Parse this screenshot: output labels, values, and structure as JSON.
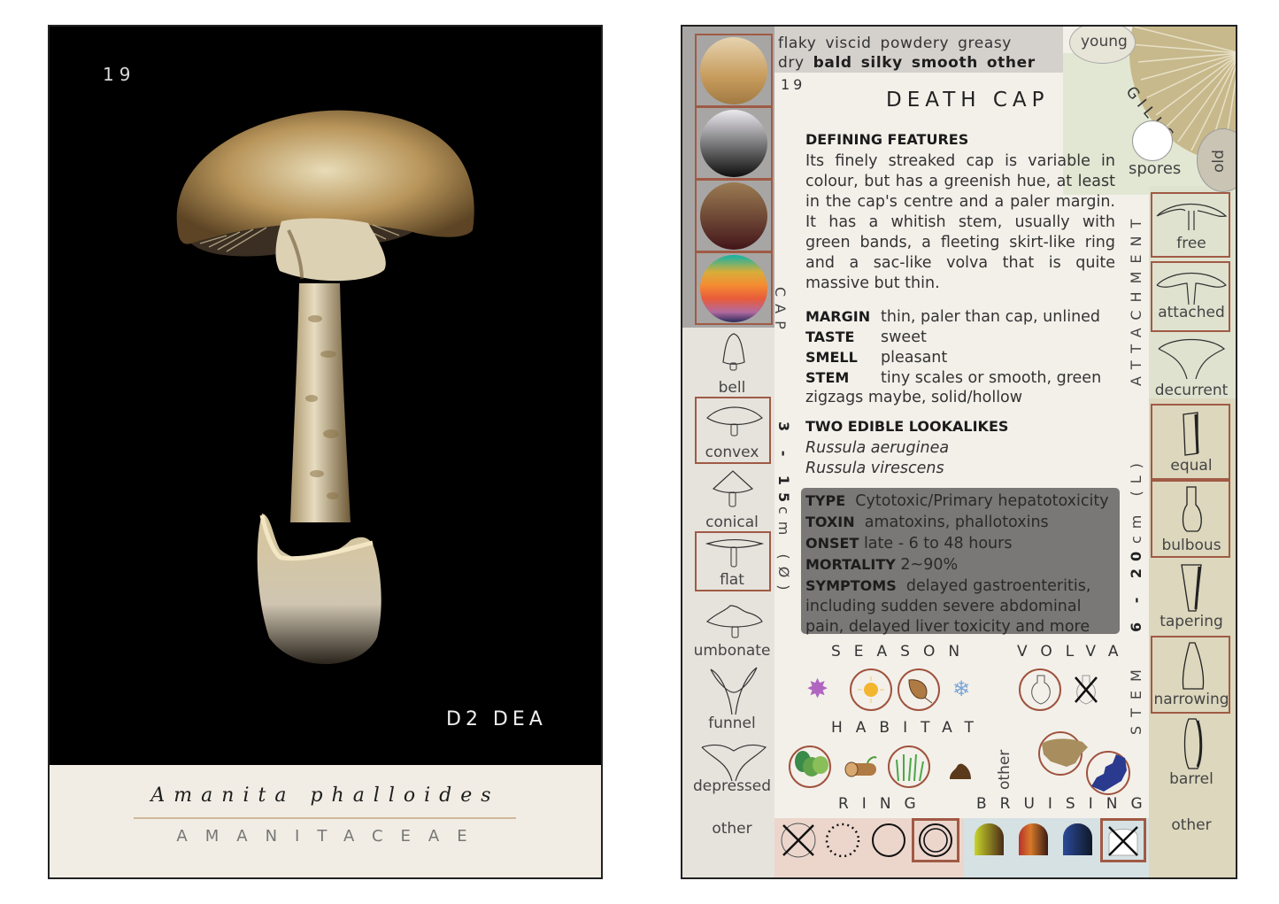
{
  "front": {
    "number": "19",
    "code": "D2 DEA",
    "latin_name": "Amanita phalloides",
    "family": "AMANITACEAE",
    "background_color": "#000000",
    "plate_color": "#f1ede4"
  },
  "back": {
    "textures": {
      "row1": [
        "flaky",
        "viscid",
        "powdery",
        "greasy"
      ],
      "row2_plain": [
        "dry"
      ],
      "row2_bold": [
        "bald",
        "silky",
        "smooth",
        "other"
      ]
    },
    "card_number": "19",
    "title": "DEATH CAP",
    "defining_features": {
      "heading": "DEFINING FEATURES",
      "text": "Its finely streaked cap is variable in colour, but has a greenish hue, at least in the cap's centre and a paler margin. It has a whitish stem, usually with green bands, a fleeting skirt-like ring and a sac-like volva that is quite massive but thin."
    },
    "attributes": [
      {
        "key": "MARGIN",
        "value": "thin, paler than cap, unlined"
      },
      {
        "key": "TASTE",
        "value": "sweet"
      },
      {
        "key": "SMELL",
        "value": "pleasant"
      },
      {
        "key": "STEM",
        "value": "tiny scales or smooth, green"
      }
    ],
    "stem_continuation": "zigzags maybe, solid/hollow",
    "lookalikes": {
      "heading": "TWO EDIBLE LOOKALIKES",
      "items": [
        "Russula aeruginea",
        "Russula virescens"
      ]
    },
    "toxicity": [
      {
        "key": "TYPE",
        "value": "Cytotoxic/Primary hepatotoxicity"
      },
      {
        "key": "TOXIN",
        "value": "amatoxins, phallotoxins"
      },
      {
        "key": "ONSET",
        "value": "late - 6 to 48 hours"
      },
      {
        "key": "MORTALITY",
        "value": "2~90%"
      },
      {
        "key": "SYMPTOMS",
        "value": "delayed gastroenteritis,"
      }
    ],
    "symptoms_continuation": [
      "including sudden severe abdominal",
      "pain, delayed liver toxicity and more"
    ],
    "sections": {
      "season": "SEASON",
      "volva": "VOLVA",
      "habitat": "HABITAT",
      "ring": "RING",
      "bruising": "BRUISING",
      "gills": "GILLS",
      "attachment": "ATTACHMENT",
      "cap": "CAP",
      "stem": "STEM"
    },
    "cap_size": {
      "range": "3 - 15",
      "unit": "cm (Ø)"
    },
    "stem_size": {
      "range": "6 - 20",
      "unit": "cm (L)"
    },
    "colour_swatches": [
      {
        "name": "tan",
        "top": "#e6d3b0",
        "bottom": "#b78a4c",
        "selected": true
      },
      {
        "name": "grey-black",
        "top": "#e8e6ea",
        "bottom": "#121212",
        "selected": true
      },
      {
        "name": "brown-maroon",
        "top": "#94774e",
        "bottom": "#4a1a1c",
        "selected": true
      },
      {
        "name": "multicolour",
        "selected": true
      }
    ],
    "cap_shapes": [
      {
        "label": "bell",
        "selected": false
      },
      {
        "label": "convex",
        "selected": true
      },
      {
        "label": "conical",
        "selected": false
      },
      {
        "label": "flat",
        "selected": true
      },
      {
        "label": "umbonate",
        "selected": false
      },
      {
        "label": "funnel",
        "selected": false
      },
      {
        "label": "depressed",
        "selected": false
      },
      {
        "label": "other",
        "selected": false
      }
    ],
    "gill_labels": {
      "young": "young",
      "old": "old",
      "spores": "spores"
    },
    "attachment_types": [
      {
        "label": "free",
        "selected": true
      },
      {
        "label": "attached",
        "selected": true
      },
      {
        "label": "decurrent",
        "selected": false
      }
    ],
    "stem_shapes": [
      {
        "label": "equal",
        "selected": true
      },
      {
        "label": "bulbous",
        "selected": true
      },
      {
        "label": "tapering",
        "selected": false
      },
      {
        "label": "narrowing",
        "selected": true
      },
      {
        "label": "barrel",
        "selected": false
      },
      {
        "label": "other",
        "selected": false
      }
    ],
    "season_icons": [
      {
        "name": "spring-flower",
        "selected": false
      },
      {
        "name": "summer-sun",
        "selected": true
      },
      {
        "name": "autumn-leaf",
        "selected": true
      },
      {
        "name": "winter-snowflake",
        "selected": false
      }
    ],
    "volva_icons": [
      {
        "name": "volva-present",
        "selected": true
      },
      {
        "name": "volva-absent",
        "selected": false
      }
    ],
    "habitat_icons": [
      {
        "name": "forest",
        "selected": true
      },
      {
        "name": "wood-log",
        "selected": false
      },
      {
        "name": "grass",
        "selected": true
      },
      {
        "name": "dung",
        "selected": false
      }
    ],
    "habitat_other_label": "other",
    "region_icons": [
      {
        "name": "north-america",
        "selected": true
      },
      {
        "name": "europe",
        "selected": true
      }
    ],
    "ring_types": [
      {
        "name": "no-ring",
        "selected": false
      },
      {
        "name": "fleeting-ring",
        "selected": false
      },
      {
        "name": "ragged-ring",
        "selected": false
      },
      {
        "name": "double-ring",
        "selected": true
      }
    ],
    "bruising_colours": [
      {
        "name": "yellow-brown",
        "selected": false
      },
      {
        "name": "orange-brown",
        "selected": false
      },
      {
        "name": "blue-black",
        "selected": false
      },
      {
        "name": "none",
        "selected": true
      }
    ],
    "accent_color": "#a05a45"
  }
}
